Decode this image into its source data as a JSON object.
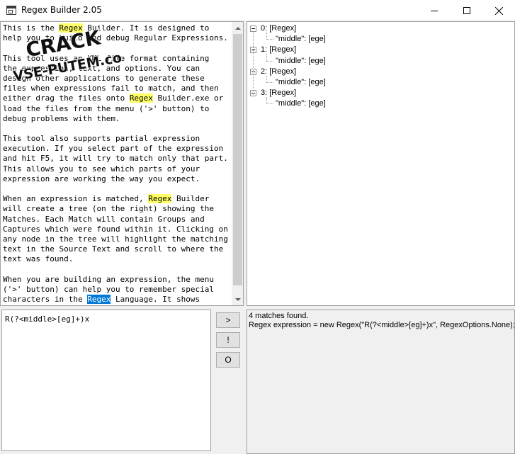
{
  "window": {
    "title": "Regex Builder 2.05"
  },
  "source": {
    "lines": [
      [
        {
          "t": "This is the "
        },
        {
          "t": "Regex",
          "hl": true
        },
        {
          "t": " Builder. It is designed to"
        }
      ],
      [
        {
          "t": "help you to build and debug Regular Expressions."
        }
      ],
      [
        {
          "t": ""
        }
      ],
      [
        {
          "t": "This tool uses an XML file format containing"
        }
      ],
      [
        {
          "t": "the expression, text, and options. You can"
        }
      ],
      [
        {
          "t": "design other applications to generate these"
        }
      ],
      [
        {
          "t": "files when expressions fail to match, and then"
        }
      ],
      [
        {
          "t": "either drag the files onto "
        },
        {
          "t": "Regex",
          "hl": true
        },
        {
          "t": " Builder.exe or"
        }
      ],
      [
        {
          "t": "load the files from the menu ('>' button) to"
        }
      ],
      [
        {
          "t": "debug problems with them."
        }
      ],
      [
        {
          "t": ""
        }
      ],
      [
        {
          "t": "This tool also supports partial expression"
        }
      ],
      [
        {
          "t": "execution. If you select part of the expression"
        }
      ],
      [
        {
          "t": "and hit F5, it will try to match only that part."
        }
      ],
      [
        {
          "t": "This allows you to see which parts of your"
        }
      ],
      [
        {
          "t": "expression are working the way you expect."
        }
      ],
      [
        {
          "t": ""
        }
      ],
      [
        {
          "t": "When an expression is matched, "
        },
        {
          "t": "Regex",
          "hl": true
        },
        {
          "t": " Builder"
        }
      ],
      [
        {
          "t": "will create a tree (on the right) showing the"
        }
      ],
      [
        {
          "t": "Matches. Each Match will contain Groups and"
        }
      ],
      [
        {
          "t": "Captures which were found within it. Clicking on"
        }
      ],
      [
        {
          "t": "any node in the tree will highlight the matching"
        }
      ],
      [
        {
          "t": "text in the Source Text and scroll to where the"
        }
      ],
      [
        {
          "t": "text was found."
        }
      ],
      [
        {
          "t": ""
        }
      ],
      [
        {
          "t": "When you are building an expression, the menu"
        }
      ],
      [
        {
          "t": "('>' button) can help you to remember special"
        }
      ],
      [
        {
          "t": "characters in the "
        },
        {
          "t": "Regex",
          "sel": true
        },
        {
          "t": " Language. It shows"
        }
      ]
    ]
  },
  "tree": {
    "matches": [
      {
        "label": "0: [Regex]",
        "group": "\"middle\": [ege]"
      },
      {
        "label": "1: [Regex]",
        "group": "\"middle\": [ege]"
      },
      {
        "label": "2: [Regex]",
        "group": "\"middle\": [ege]"
      },
      {
        "label": "3: [Regex]",
        "group": "\"middle\": [ege]"
      }
    ]
  },
  "expression": {
    "value": "R(?<middle>[eg]+)x"
  },
  "buttons": {
    "run_label": ">",
    "partial_label": "!",
    "options_label": "O"
  },
  "result": {
    "line1": "4 matches found.",
    "line2": "Regex expression = new Regex(\"R(?<middle>[eg]+)x\", RegexOptions.None);"
  },
  "watermark": {
    "line1": "CRACK",
    "line2": "VSE-PUTEM.com"
  },
  "colors": {
    "highlight": "#ffff66",
    "selection": "#0078d7",
    "watermark": "#111111"
  }
}
